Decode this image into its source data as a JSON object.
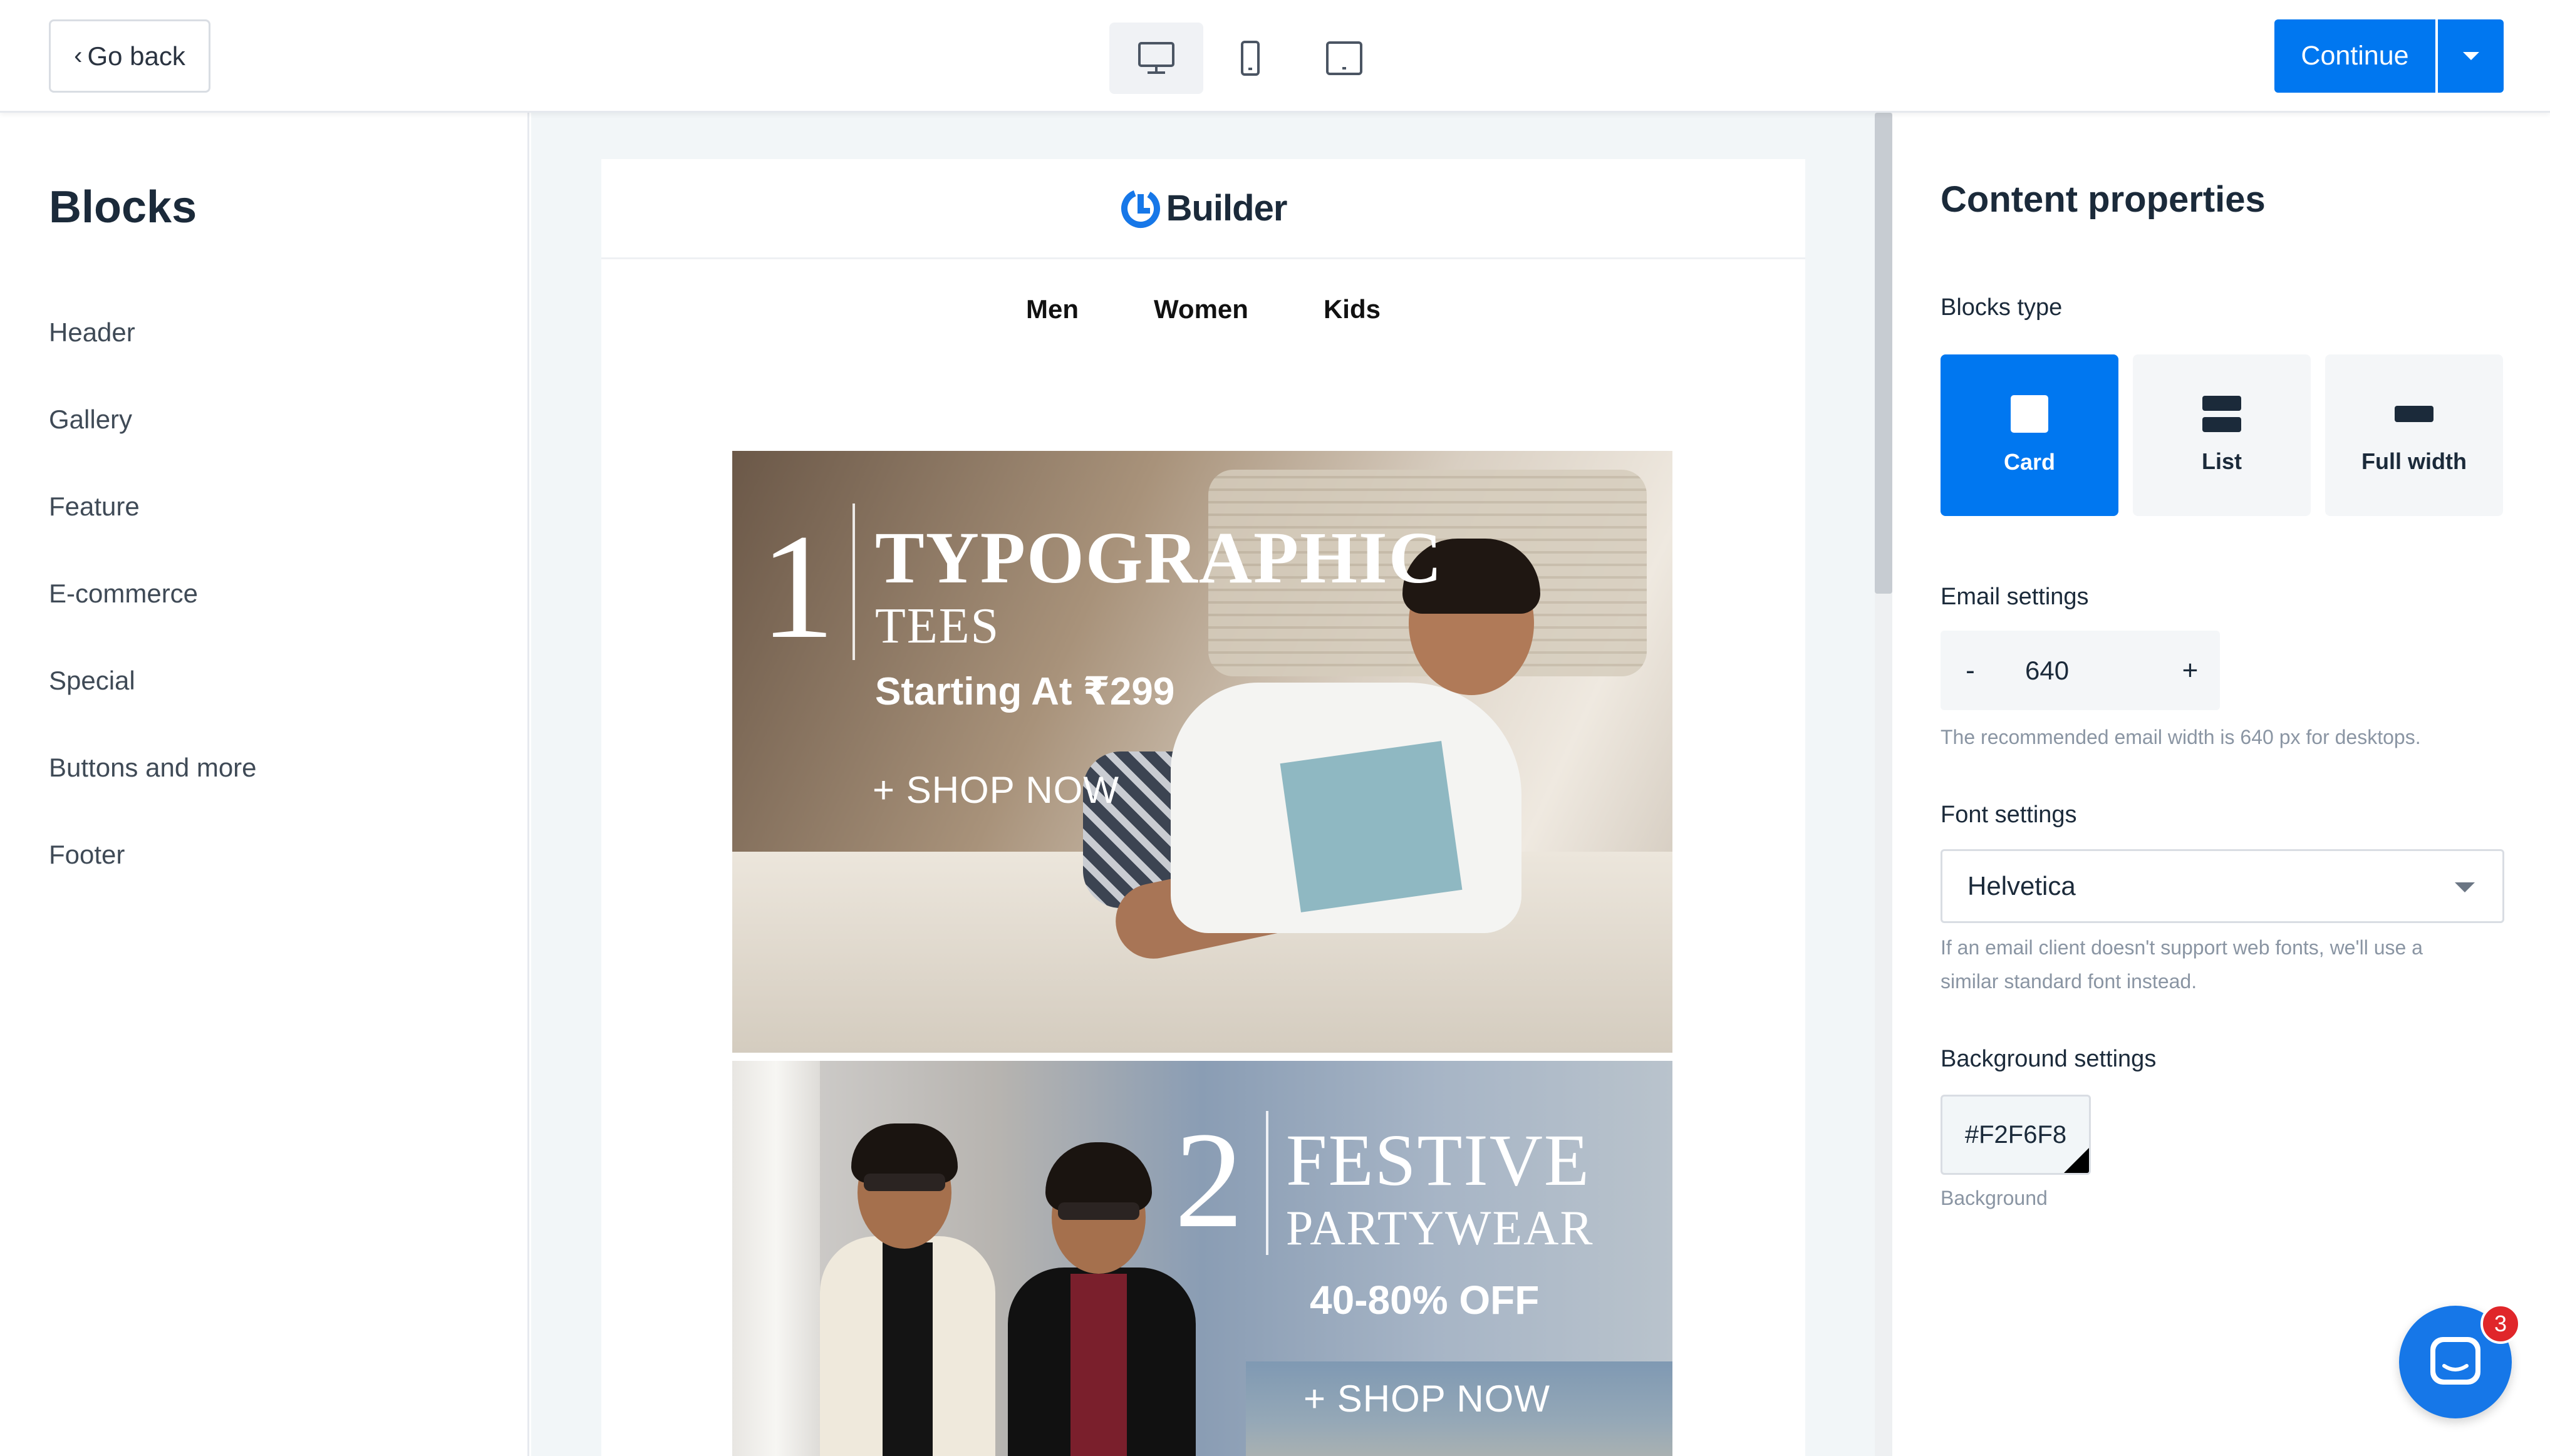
{
  "topbar": {
    "back_label": "Go back",
    "devices": [
      {
        "name": "desktop",
        "icon": "monitor-icon",
        "active": true
      },
      {
        "name": "mobile",
        "icon": "phone-icon",
        "active": false
      },
      {
        "name": "tablet",
        "icon": "tablet-icon",
        "active": false
      }
    ],
    "continue_label": "Continue"
  },
  "sidebar": {
    "title": "Blocks",
    "items": [
      {
        "label": "Header"
      },
      {
        "label": "Gallery"
      },
      {
        "label": "Feature"
      },
      {
        "label": "E-commerce"
      },
      {
        "label": "Special"
      },
      {
        "label": "Buttons and more"
      },
      {
        "label": "Footer"
      }
    ]
  },
  "email": {
    "brand": "Builder",
    "nav": [
      "Men",
      "Women",
      "Kids"
    ],
    "banner1": {
      "number": "1",
      "title_line1": "TYPOGRAPHIC",
      "title_line2": "TEES",
      "offer": "Starting At ₹299",
      "cta": "+ SHOP NOW"
    },
    "banner2": {
      "number": "2",
      "title_line1": "FESTIVE",
      "title_line2": "PARTYWEAR",
      "offer": "40-80% OFF",
      "cta": "+ SHOP NOW"
    }
  },
  "panel": {
    "title": "Content properties",
    "blocks_type_label": "Blocks type",
    "blocks_types": [
      {
        "label": "Card",
        "active": true
      },
      {
        "label": "List",
        "active": false
      },
      {
        "label": "Full width",
        "active": false
      }
    ],
    "email_settings_label": "Email settings",
    "email_width": "640",
    "stepper_minus": "-",
    "stepper_plus": "+",
    "email_hint": "The recommended email width is 640 px for desktops.",
    "font_settings_label": "Font settings",
    "font_value": "Helvetica",
    "font_hint_line1": "If an email client doesn't support web fonts, we'll use a",
    "font_hint_line2": "similar standard font instead.",
    "background_settings_label": "Background settings",
    "background_value": "#F2F6F8",
    "background_caption": "Background"
  },
  "chat": {
    "badge_count": "3"
  },
  "colors": {
    "accent": "#0077F0",
    "canvas_bg": "#F2F6F8",
    "badge": "#E0262A"
  }
}
